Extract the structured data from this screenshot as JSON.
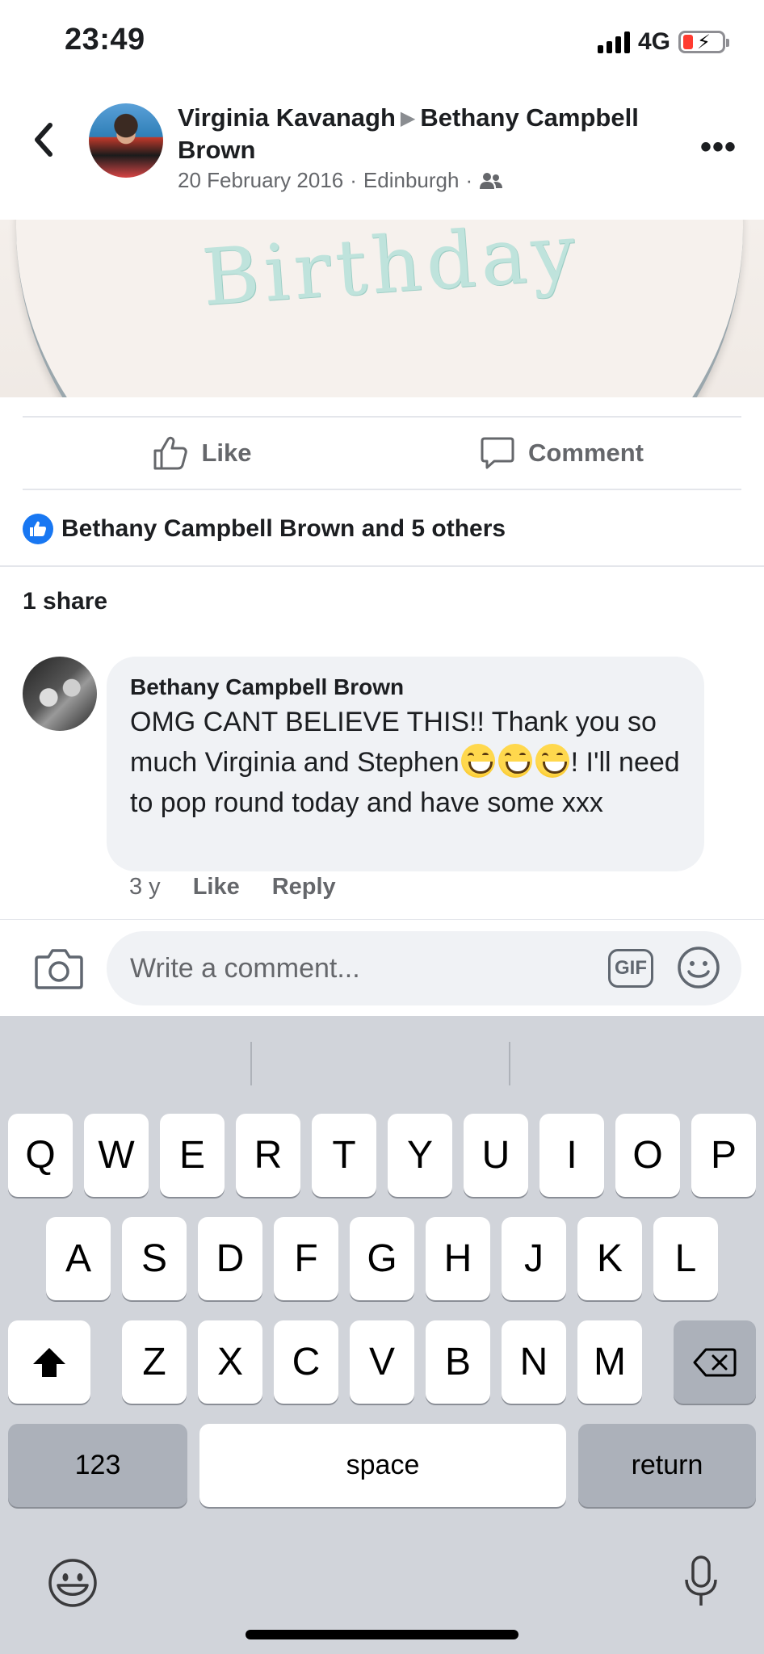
{
  "status": {
    "time": "23:49",
    "network": "4G"
  },
  "post": {
    "author": "Virginia Kavanagh",
    "recipient": "Bethany Campbell Brown",
    "date": "20 February 2016",
    "location": "Edinburgh",
    "separator": "·",
    "image_text": "Birthday"
  },
  "actions": {
    "like": "Like",
    "comment": "Comment"
  },
  "reactions": {
    "summary": "Bethany Campbell Brown and 5 others"
  },
  "shares": "1 share",
  "comment": {
    "author": "Bethany Campbell Brown",
    "text_part1": "OMG CANT BELIEVE THIS!! Thank you so much Virginia and Stephen",
    "text_part2": "! I'll need to pop round today and have some xxx",
    "emoji_count": 3,
    "age": "3 y",
    "like": "Like",
    "reply": "Reply"
  },
  "compose": {
    "placeholder": "Write a comment...",
    "gif": "GIF"
  },
  "keyboard": {
    "row1": [
      "Q",
      "W",
      "E",
      "R",
      "T",
      "Y",
      "U",
      "I",
      "O",
      "P"
    ],
    "row2": [
      "A",
      "S",
      "D",
      "F",
      "G",
      "H",
      "J",
      "K",
      "L"
    ],
    "row3": [
      "Z",
      "X",
      "C",
      "V",
      "B",
      "N",
      "M"
    ],
    "numbers": "123",
    "space": "space",
    "return": "return"
  }
}
